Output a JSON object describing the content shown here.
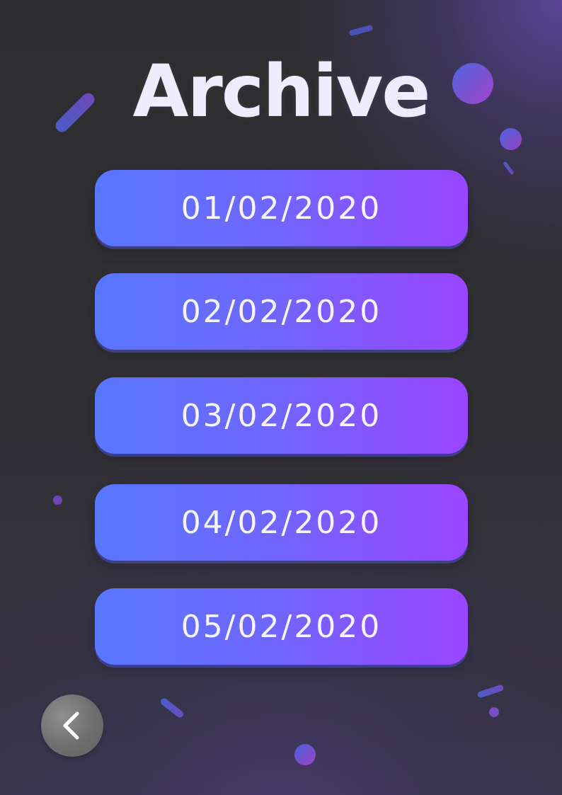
{
  "page": {
    "title": "Archive",
    "background_colors": [
      "#2d2d2f",
      "#313035",
      "#38344a"
    ],
    "accent_colors": [
      "#5876ff",
      "#6e67ff",
      "#9a45ff"
    ]
  },
  "archive": {
    "dates": [
      "01/02/2020",
      "02/02/2020",
      "03/02/2020",
      "04/02/2020",
      "05/02/2020"
    ]
  },
  "navigation": {
    "back_icon": "chevron-left-icon"
  },
  "decorations": {
    "shapes": [
      "confetti-bar",
      "confetti-bar",
      "confetti-circle",
      "confetti-circle",
      "confetti-bar",
      "confetti-dot",
      "confetti-bar",
      "confetti-dot",
      "confetti-circle",
      "confetti-bar"
    ]
  }
}
